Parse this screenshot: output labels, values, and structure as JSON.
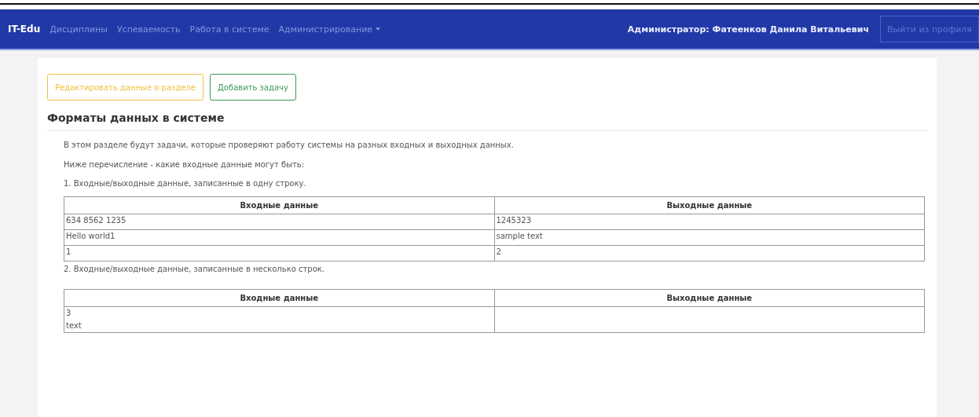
{
  "navbar": {
    "brand": "IT-Edu",
    "links": [
      {
        "label": "Дисциплины",
        "kind": "link"
      },
      {
        "label": "Успеваемость",
        "kind": "link"
      },
      {
        "label": "Работа в системе",
        "kind": "link"
      },
      {
        "label": "Администрирование",
        "kind": "dropdown"
      }
    ],
    "user": "Администратор: Фатеенков Данила Витальевич",
    "logout": "Выйти из профиля"
  },
  "actions": [
    {
      "label": "Редактировать данные о разделе",
      "kind": "warning"
    },
    {
      "label": "Добавить задачу",
      "kind": "success"
    }
  ],
  "section_title": "Форматы данных в системе",
  "paragraphs": [
    "В этом разделе будут задачи, которые проверяют работу системы на разных входных и выходных данных.",
    "Ниже перечисление - какие входные данные могут быть:"
  ],
  "examples": [
    {
      "caption": "1. Входные/выходные данные, записанные в одну строку.",
      "columns": [
        "Входные данные",
        "Выходные данные"
      ],
      "rows": [
        [
          [
            "634 8562 1235"
          ],
          [
            "1245323"
          ]
        ],
        [
          [
            "Hello world1"
          ],
          [
            "sample text"
          ]
        ],
        [
          [
            "1"
          ],
          [
            "2"
          ]
        ]
      ]
    },
    {
      "caption": "2. Входные/выходные данные, записанные в несколько строк.",
      "columns": [
        "Входные данные",
        "Выходные данные"
      ],
      "rows": [
        [
          [
            "3",
            "text"
          ],
          []
        ]
      ]
    }
  ]
}
